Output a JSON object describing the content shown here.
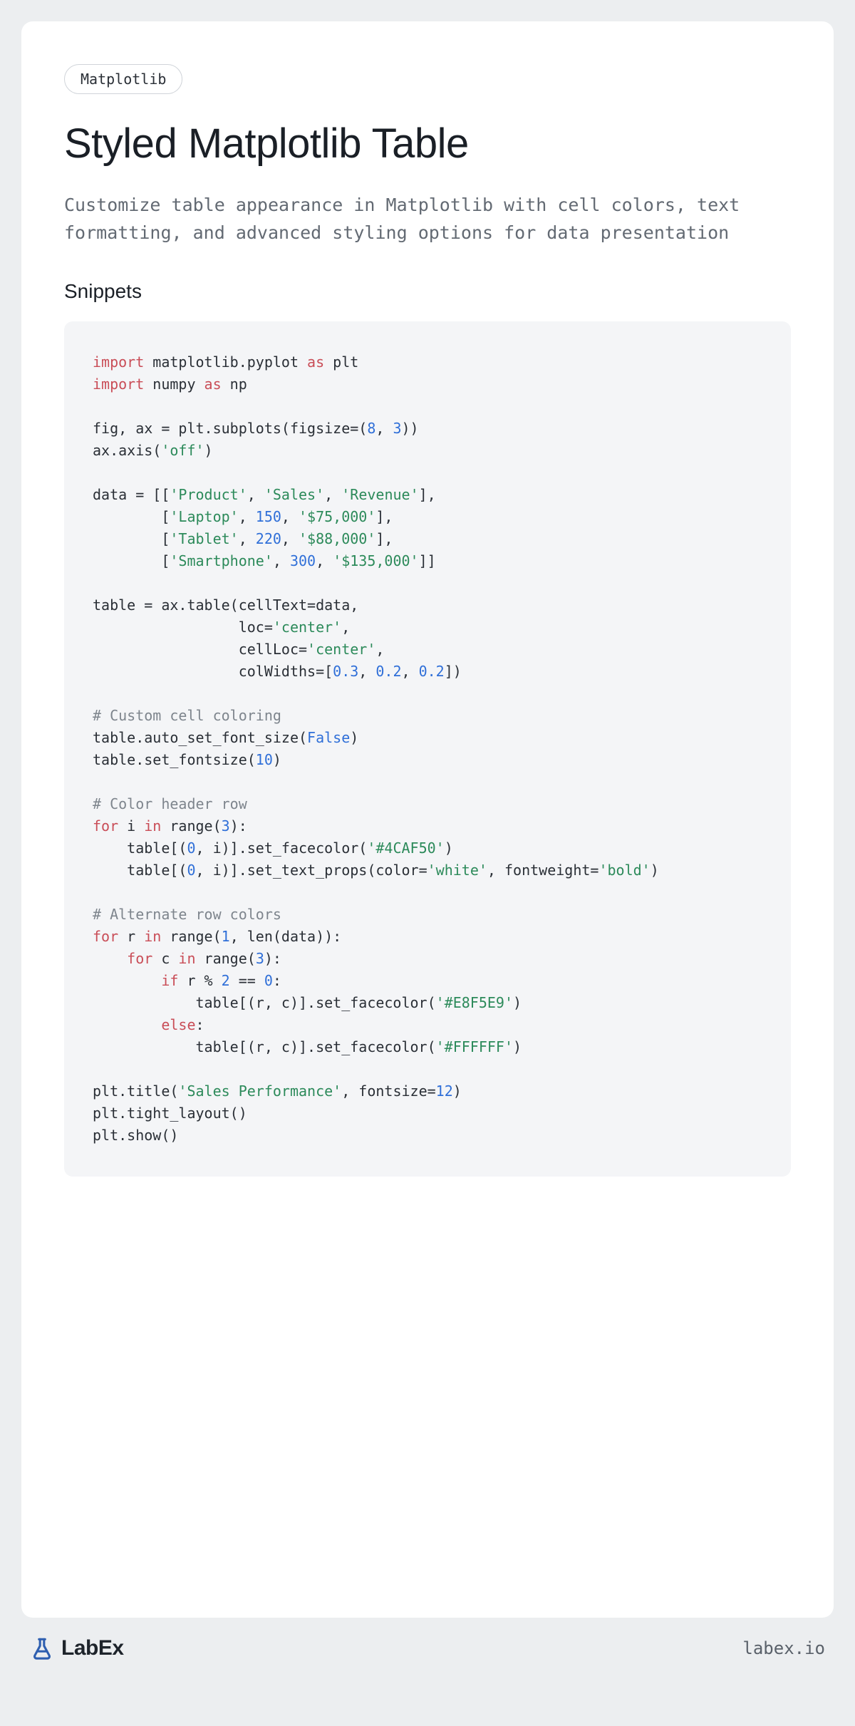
{
  "tag": "Matplotlib",
  "title": "Styled Matplotlib Table",
  "description": "Customize table appearance in Matplotlib with cell colors, text formatting, and advanced styling options for data presentation",
  "section_heading": "Snippets",
  "brand_name": "LabEx",
  "site_url": "labex.io",
  "code": {
    "import1_kw": "import",
    "import1_mod": " matplotlib.pyplot ",
    "import1_as": "as",
    "import1_alias": " plt",
    "import2_kw": "import",
    "import2_mod": " numpy ",
    "import2_as": "as",
    "import2_alias": " np",
    "l_fig": "fig, ax = plt.subplots(figsize=(",
    "n_8": "8",
    "sep1": ", ",
    "n_3": "3",
    "l_fig_end": "))",
    "l_axis": "ax.axis(",
    "s_off": "'off'",
    "rp": ")",
    "l_data_open": "data = [[",
    "s_product": "'Product'",
    "s_sales": "'Sales'",
    "s_revenue": "'Revenue'",
    "br_close1": "],",
    "indent_data": "        [",
    "s_laptop": "'Laptop'",
    "n_150": "150",
    "s_75k": "'$75,000'",
    "s_tablet": "'Tablet'",
    "n_220": "220",
    "s_88k": "'$88,000'",
    "s_smart": "'Smartphone'",
    "n_300": "300",
    "s_135k": "'$135,000'",
    "br_close_end": "]]",
    "l_table": "table = ax.table(cellText=data,",
    "l_loc": "                 loc=",
    "s_center": "'center'",
    "comma": ",",
    "l_cellLoc": "                 cellLoc=",
    "l_colw": "                 colWidths=[",
    "n_03": "0.3",
    "n_02": "0.2",
    "close_sq_paren": "])",
    "c_custom": "# Custom cell coloring",
    "l_autosize": "table.auto_set_font_size(",
    "b_false": "False",
    "l_setfont": "table.set_fontsize(",
    "n_10": "10",
    "c_header": "# Color header row",
    "kw_for": "for",
    "kw_in": "in",
    "txt_i": " i ",
    "txt_range": " range(",
    "l_for_end": "):",
    "l_tbl_idx_open": "    table[(",
    "n_0": "0",
    "l_i_close_fc": ", i)].set_facecolor(",
    "s_green": "'#4CAF50'",
    "l_i_close_tp": ", i)].set_text_props(color=",
    "s_white": "'white'",
    "sep_fw": ", fontweight=",
    "s_bold": "'bold'",
    "c_alt": "# Alternate row colors",
    "txt_r": " r ",
    "n_1": "1",
    "txt_len": ", len(data)):",
    "l_for_c": "    ",
    "txt_c": " c ",
    "kw_if": "if",
    "l_if_body": " r % ",
    "n_2": "2",
    "l_eq0": " == ",
    "colon": ":",
    "l_tbl_rc_open": "            table[(r, c)].set_facecolor(",
    "s_egreen": "'#E8F5E9'",
    "kw_else": "else",
    "s_white_hex": "'#FFFFFF'",
    "l_title": "plt.title(",
    "s_sales_perf": "'Sales Performance'",
    "l_fontsize": ", fontsize=",
    "n_12": "12",
    "l_tight": "plt.tight_layout()",
    "l_show": "plt.show()"
  }
}
